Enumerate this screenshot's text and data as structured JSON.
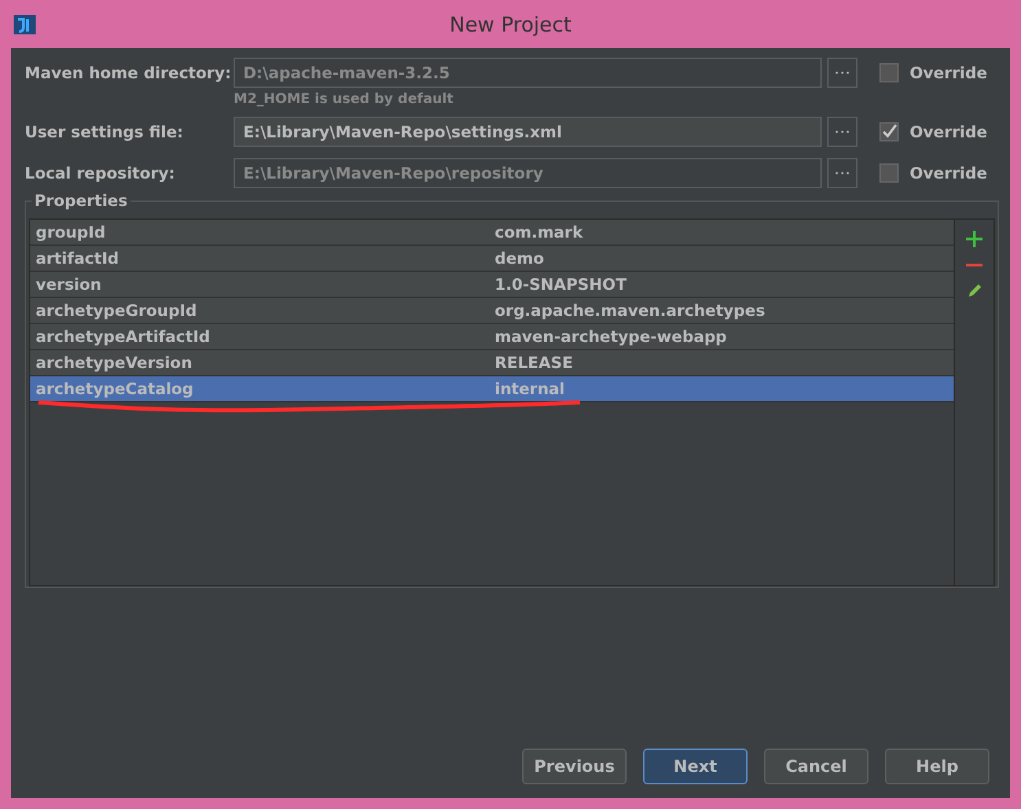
{
  "window": {
    "title": "New Project"
  },
  "fields": [
    {
      "label": "Maven home directory:",
      "value": "D:\\apache-maven-3.2.5",
      "hint": "M2_HOME is used by default",
      "disabled": true,
      "override": {
        "label": "Override",
        "checked": false
      }
    },
    {
      "label": "User settings file:",
      "value": "E:\\Library\\Maven-Repo\\settings.xml",
      "disabled": false,
      "override": {
        "label": "Override",
        "checked": true
      }
    },
    {
      "label": "Local repository:",
      "value": "E:\\Library\\Maven-Repo\\repository",
      "disabled": true,
      "override": {
        "label": "Override",
        "checked": false
      }
    }
  ],
  "properties": {
    "title": "Properties",
    "rows": [
      {
        "key": "groupId",
        "value": "com.mark",
        "selected": false
      },
      {
        "key": "artifactId",
        "value": "demo",
        "selected": false
      },
      {
        "key": "version",
        "value": "1.0-SNAPSHOT",
        "selected": false
      },
      {
        "key": "archetypeGroupId",
        "value": "org.apache.maven.archetypes",
        "selected": false
      },
      {
        "key": "archetypeArtifactId",
        "value": "maven-archetype-webapp",
        "selected": false
      },
      {
        "key": "archetypeVersion",
        "value": "RELEASE",
        "selected": false
      },
      {
        "key": "archetypeCatalog",
        "value": "internal",
        "selected": true,
        "marked": true
      }
    ]
  },
  "buttons": [
    {
      "label": "Previous",
      "default": false
    },
    {
      "label": "Next",
      "default": true
    },
    {
      "label": "Cancel",
      "default": false
    },
    {
      "label": "Help",
      "default": false
    }
  ]
}
